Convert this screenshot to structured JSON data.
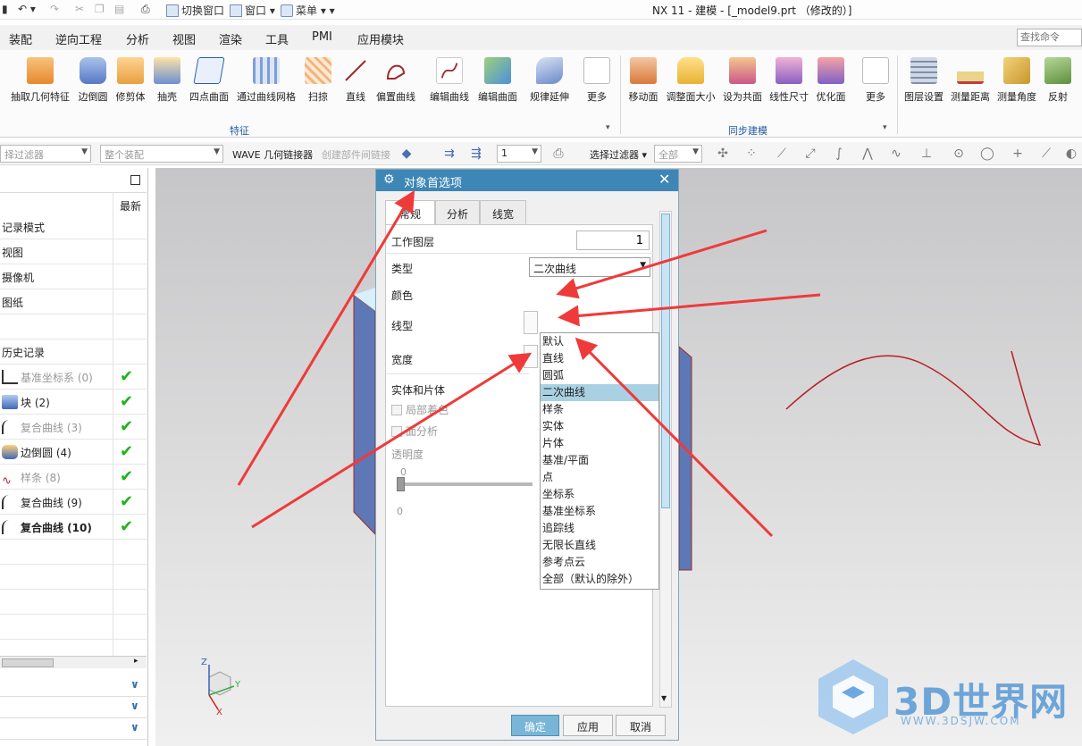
{
  "window": {
    "title": "NX 11 - 建模 - [_model9.prt （修改的）]"
  },
  "quick_access": {
    "switch_window": "切换窗口",
    "window": "窗口",
    "menu": "菜单"
  },
  "menubar": {
    "items": [
      "装配",
      "逆向工程",
      "分析",
      "视图",
      "渲染",
      "工具",
      "PMI",
      "应用模块"
    ],
    "search_placeholder": "查找命令"
  },
  "ribbon": {
    "feature_buttons": [
      "抽取几何特征",
      "边倒圆",
      "修剪体",
      "抽壳",
      "四点曲面",
      "通过曲线网格",
      "扫掠",
      "直线",
      "偏置曲线",
      "编辑曲线",
      "编辑曲面",
      "规律延伸",
      "更多"
    ],
    "feature_group": "特征",
    "sync_buttons": [
      "移动面",
      "调整面大小",
      "设为共面",
      "线性尺寸",
      "优化面",
      "更多"
    ],
    "sync_group": "同步建模",
    "right_buttons": [
      "图层设置",
      "测量距离",
      "测量角度",
      "反射"
    ]
  },
  "filterbar": {
    "type_filter": "择过滤器",
    "assembly_scope": "整个装配",
    "wave_label": "WAVE 几何链接器",
    "link_label": "创建部件间链接",
    "layer_value": "1",
    "select_filter": "选择过滤器",
    "all_value": "全部"
  },
  "navigator": {
    "header_latest": "最新",
    "rows": [
      {
        "label": "记录模式"
      },
      {
        "label": "视图"
      },
      {
        "label": "摄像机"
      },
      {
        "label": "图纸"
      },
      {
        "label": ""
      },
      {
        "label": "历史记录"
      }
    ],
    "features": [
      {
        "label": "基准坐标系 (0)",
        "style": "gray"
      },
      {
        "label": "块 (2)",
        "style": "normal"
      },
      {
        "label": "复合曲线 (3)",
        "style": "gray"
      },
      {
        "label": "边倒圆 (4)",
        "style": "normal"
      },
      {
        "label": "样条 (8)",
        "style": "gray"
      },
      {
        "label": "复合曲线 (9)",
        "style": "normal"
      },
      {
        "label": "复合曲线 (10)",
        "style": "bold"
      }
    ]
  },
  "dialog": {
    "title": "对象首选项",
    "tabs": [
      "常规",
      "分析",
      "线宽"
    ],
    "work_layer_label": "工作图层",
    "work_layer_value": "1",
    "type_label": "类型",
    "type_value": "二次曲线",
    "color_label": "颜色",
    "linetype_label": "线型",
    "width_label": "宽度",
    "solid_sheet_label": "实体和片体",
    "local_shading_label": "局部着色",
    "face_analysis_label": "面分析",
    "transparency_label": "透明度",
    "transparency_top": "0",
    "transparency_bottom": "0",
    "type_options": [
      "默认",
      "直线",
      "圆弧",
      "二次曲线",
      "样条",
      "实体",
      "片体",
      "基准/平面",
      "点",
      "坐标系",
      "基准坐标系",
      "追踪线",
      "无限长直线",
      "参考点云",
      "全部（默认的除外）"
    ],
    "selected_option_index": 3,
    "ok": "确定",
    "apply": "应用",
    "cancel": "取消"
  },
  "triad": {
    "x": "X",
    "y": "Y",
    "z": "Z"
  },
  "watermark": {
    "text": "3D世界网",
    "url": "WWW.3DSJW.COM"
  },
  "colors": {
    "dialog_title": "#3d86b6",
    "selection": "#a9d1e3",
    "annotation_arrow": "#ef3a3a",
    "check": "#1db21d",
    "ok_button": "#79b5d6"
  }
}
